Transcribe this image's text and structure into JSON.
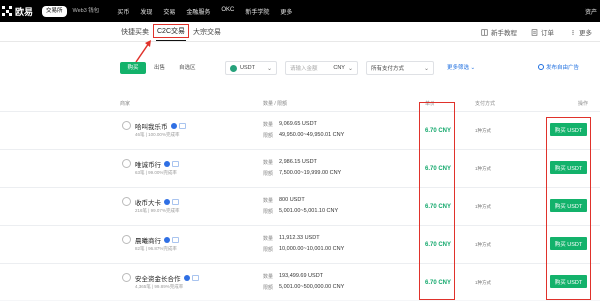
{
  "app": {
    "brand": "欧易",
    "mode_tabs": [
      "交易所",
      "Web3 钱包"
    ]
  },
  "topnav": {
    "items": [
      "买币",
      "发现",
      "交易",
      "金融服务",
      "OKC",
      "新手学院",
      "更多"
    ],
    "right": "资产"
  },
  "subnav": {
    "tabs": [
      "快捷买卖",
      "C2C交易",
      "大宗交易"
    ],
    "active_tab": "C2C交易",
    "actions": [
      "新手教程",
      "订单",
      "更多"
    ]
  },
  "filter": {
    "side_tabs": [
      "购买",
      "出售",
      "自选区"
    ],
    "asset": "USDT",
    "amount_placeholder": "请输入金额",
    "currency": "CNY",
    "payment_placeholder": "所有支付方式",
    "advanced": "更多筛选",
    "post_ad": "发布自由广告"
  },
  "table": {
    "headers": [
      "商家",
      "数量 / 限额",
      "单价",
      "支付方式",
      "操作"
    ],
    "quantity_label": "数量",
    "limit_label": "限额",
    "rows": [
      {
        "merchant": "哈叫我乐币",
        "stats": "46笔 | 100.00%完成率",
        "quantity": "9,069.65 USDT",
        "limit": "49,950.00~49,950.01 CNY",
        "price": "6.70 CNY",
        "payment": "1种方式",
        "action": "购买 USDT"
      },
      {
        "merchant": "唯诚币行",
        "stats": "63笔 | 99.00%完成率",
        "quantity": "2,986.15 USDT",
        "limit": "7,500.00~19,999.00 CNY",
        "price": "6.70 CNY",
        "payment": "1种方式",
        "action": "购买 USDT"
      },
      {
        "merchant": "收币大卡",
        "stats": "216笔 | 99.07%完成率",
        "quantity": "800 USDT",
        "limit": "5,001.00~5,001.10 CNY",
        "price": "6.70 CNY",
        "payment": "1种方式",
        "action": "购买 USDT"
      },
      {
        "merchant": "晨曦商行",
        "stats": "82笔 | 96.87%完成率",
        "quantity": "11,912.33 USDT",
        "limit": "10,000.00~10,001.00 CNY",
        "price": "6.70 CNY",
        "payment": "1种方式",
        "action": "购买 USDT"
      },
      {
        "merchant": "安全资金长合作",
        "stats": "4,365笔 | 99.89%完成率",
        "quantity": "193,499.69 USDT",
        "limit": "5,001.00~500,000.00 CNY",
        "price": "6.70 CNY",
        "payment": "1种方式",
        "action": "购买 USDT"
      }
    ]
  },
  "colors": {
    "accent_green": "#13b26b",
    "price_green": "#13a86c",
    "annotation_red": "#e0322b",
    "link_blue": "#1f6fe0"
  }
}
